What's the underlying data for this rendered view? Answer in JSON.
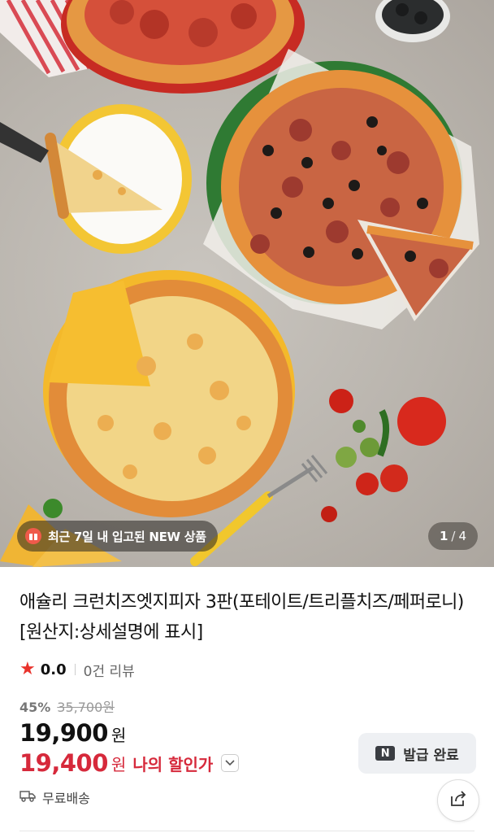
{
  "gallery": {
    "badge_text": "최근 7일 내 입고된 NEW 상품",
    "badge_icon": "gift-icon",
    "current_page": "1",
    "separator": "/",
    "total_pages": "4"
  },
  "product": {
    "title": "애슐리 크런치즈엣지피자 3판(포테이트/트리플치즈/페퍼로니) [원산지:상세설명에 표시]",
    "rating": "0.0",
    "review_count": "0건 리뷰",
    "discount_percent": "45%",
    "original_price": "35,700원",
    "price": "19,900",
    "price_unit": "원",
    "my_price": "19,400",
    "my_price_unit": "원",
    "my_price_label": "나의 할인가",
    "coupon_icon_text": "N",
    "coupon_label": "발급 완료",
    "shipping_label": "무료배송"
  },
  "colors": {
    "accent_red": "#d6293b",
    "star": "#e9322b",
    "coupon_bg": "#eef0f3"
  },
  "icons": [
    "gift-icon",
    "star-icon",
    "chevron-down-icon",
    "coupon-icon",
    "truck-icon",
    "share-icon"
  ]
}
